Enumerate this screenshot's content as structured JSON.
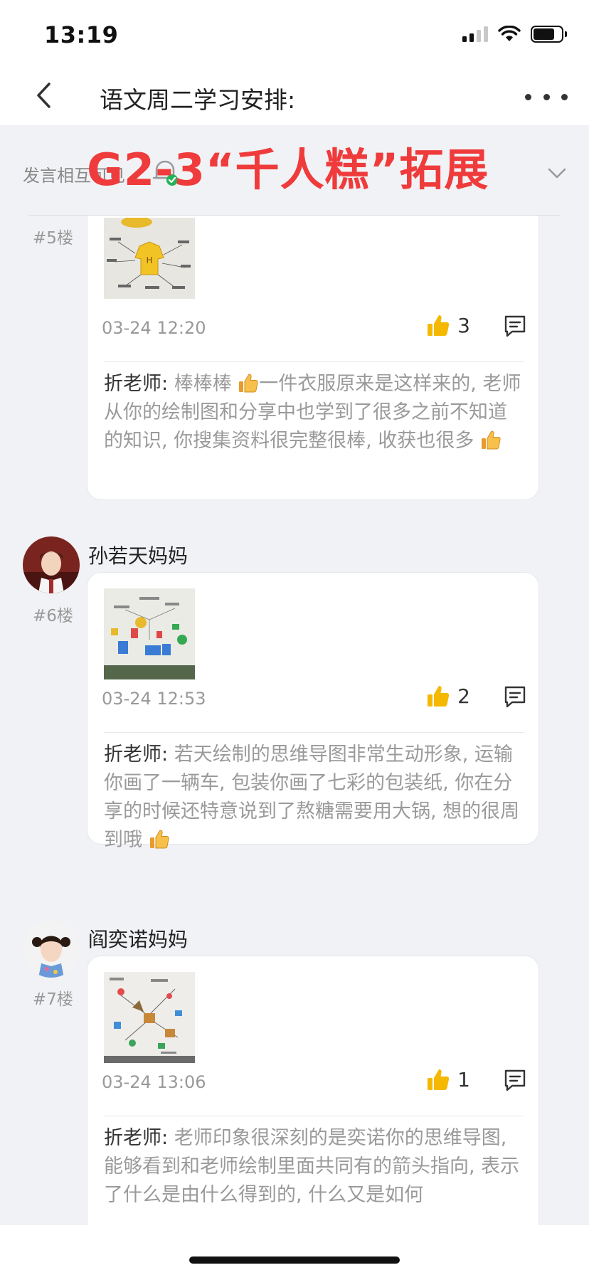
{
  "status": {
    "time": "13:19"
  },
  "nav": {
    "title": "语文周二学习安排:"
  },
  "subheader": {
    "label": "发言相互可见",
    "overlay_title": "G2-3“千人糕”拓展"
  },
  "colors": {
    "accent_red": "#ef3b3b",
    "like_yellow": "#f5b800",
    "check_green": "#22b35a"
  },
  "posts": [
    {
      "floor": "#5楼",
      "time": "03-24 12:20",
      "likes": "3",
      "reply": {
        "author": "折老师:",
        "p1": " 棒棒棒",
        "p2": "一件衣服原来是这样来的, 老师从你的绘制图和分享中也学到了很多之前不知道的知识, 你搜集资料很完整很棒, 收获也很多"
      }
    },
    {
      "floor": "#6楼",
      "name": "孙若天妈妈",
      "time": "03-24 12:53",
      "likes": "2",
      "reply": {
        "author": "折老师:",
        "p1": " 若天绘制的思维导图非常生动形象, 运输你画了一辆车, 包装你画了七彩的包装纸, 你在分享的时候还特意说到了熬糖需要用大锅, 想的很周到哦"
      }
    },
    {
      "floor": "#7楼",
      "name": "阎奕诺妈妈",
      "time": "03-24 13:06",
      "likes": "1",
      "reply": {
        "author": "折老师:",
        "p1": " 老师印象很深刻的是奕诺你的思维导图, 能够看到和老师绘制里面共同有的箭头指向, 表示了什么是由什么得到的, 什么又是如何"
      }
    }
  ]
}
